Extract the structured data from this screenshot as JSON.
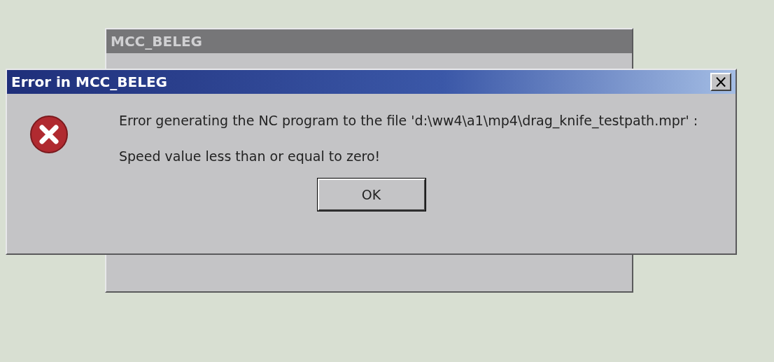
{
  "back_window": {
    "title": "MCC_BELEG",
    "active": false
  },
  "dialog": {
    "title": "Error in MCC_BELEG",
    "active": true,
    "kind": "error",
    "message": "Error generating the NC program to the file 'd:\\ww4\\a1\\mp4\\drag_knife_testpath.mpr' :",
    "detail": "Speed value less than or equal to zero!",
    "close_button": "×",
    "buttons": [
      {
        "label": "OK",
        "selected": true
      }
    ]
  }
}
